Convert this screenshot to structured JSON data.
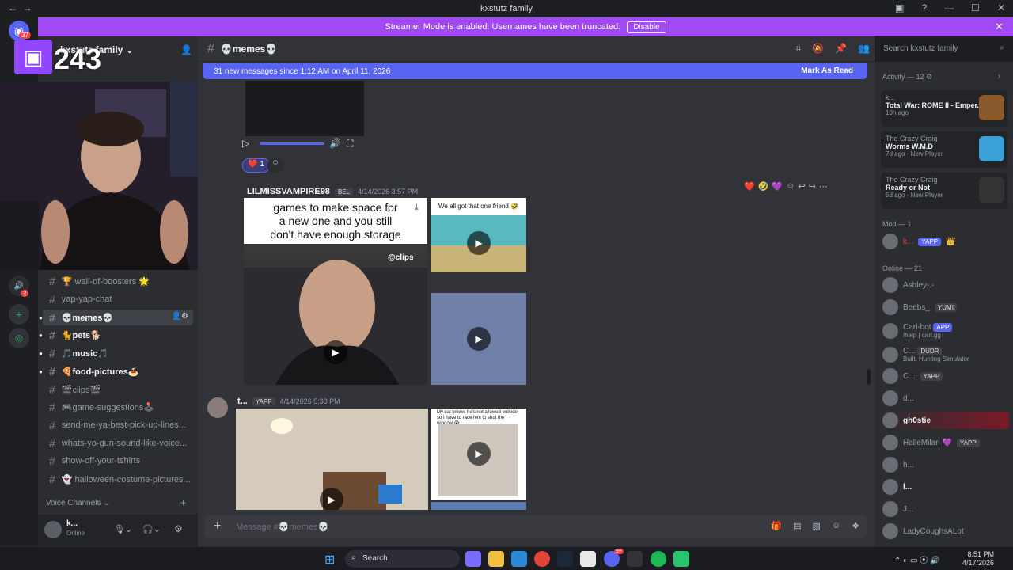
{
  "window": {
    "title": "kxstutz family"
  },
  "banner": {
    "text": "Streamer Mode is enabled. Usernames have been truncated.",
    "button": "Disable"
  },
  "server": {
    "name": "kxstutz family"
  },
  "overlay": {
    "viewer_count": "243"
  },
  "rail": {
    "badges": [
      "37",
      "2"
    ]
  },
  "channels": [
    {
      "label": "🏆 wall-of-boosters 🌟",
      "style": "normal"
    },
    {
      "label": "yap-yap-chat",
      "style": "normal"
    },
    {
      "label": "💀memes💀",
      "style": "active"
    },
    {
      "label": "🐈pets🐕",
      "style": "bold"
    },
    {
      "label": "🎵music🎵",
      "style": "bold"
    },
    {
      "label": "🍕food-pictures🍝",
      "style": "bold"
    },
    {
      "label": "🎬clips🎬",
      "style": "normal"
    },
    {
      "label": "🎮game-suggestions🕹️",
      "style": "normal"
    },
    {
      "label": "send-me-ya-best-pick-up-lines...",
      "style": "normal"
    },
    {
      "label": "whats-yo-gun-sound-like-voice...",
      "style": "normal"
    },
    {
      "label": "show-off-your-tshirts",
      "style": "normal"
    },
    {
      "label": "👻 halloween-costume-pictures...",
      "style": "normal"
    }
  ],
  "voice_header": "Voice Channels",
  "user_panel": {
    "name": "k...",
    "status": "Online"
  },
  "header": {
    "channel": "💀memes💀",
    "search_placeholder": "Search kxstutz family"
  },
  "new_messages": {
    "text": "31 new messages since 1:12 AM on April 11, 2026",
    "action": "Mark As Read"
  },
  "reactions": {
    "count": "1"
  },
  "messages": [
    {
      "author": "LILMISSVAMPIRE98",
      "tag": "BEL",
      "timestamp": "4/14/2026 3:57 PM",
      "caption_lines": [
        "games to make space for",
        "a new one and you still",
        "don't have enough storage"
      ],
      "watermark": "@clips",
      "side_caption": "We all got that one friend 🤣"
    },
    {
      "author": "t...",
      "tag": "YAPP",
      "timestamp": "4/14/2026 5:38 PM",
      "side_caption": "My cat knows he's not allowed outside so I have to race him to shut the window 😭"
    }
  ],
  "composer": {
    "placeholder": "Message #💀memes💀"
  },
  "activity": {
    "header": "Activity — 12",
    "cards": [
      {
        "user": "k...",
        "title": "Total War: ROME II - Emper...",
        "meta": "10h ago"
      },
      {
        "user": "The Crazy Craig",
        "title": "Worms W.M.D",
        "meta": "7d ago",
        "extra": "New Player"
      },
      {
        "user": "The Crazy Craig",
        "title": "Ready or Not",
        "meta": "5d ago",
        "extra": "New Player"
      }
    ]
  },
  "mod_section": {
    "header": "Mod — 1",
    "members": [
      {
        "name": "k...",
        "tag": "YAPP"
      }
    ]
  },
  "online_section": {
    "header": "Online — 21",
    "members": [
      {
        "name": "Ashley-.-",
        "tag": "",
        "sub": ""
      },
      {
        "name": "Beebs_",
        "tag": "YUMI",
        "sub": ""
      },
      {
        "name": "Carl-bot",
        "tag": "APP",
        "sub": "/help | carl.gg"
      },
      {
        "name": "C...",
        "tag": "DUDR",
        "sub": "Built: Hunting Simulator"
      },
      {
        "name": "C...",
        "tag": "YAPP",
        "sub": ""
      },
      {
        "name": "d...",
        "tag": "",
        "sub": ""
      },
      {
        "name": "gh0stie",
        "tag": "",
        "sub": ""
      },
      {
        "name": "HalleMilan 💜",
        "tag": "YAPP",
        "sub": ""
      },
      {
        "name": "h...",
        "tag": "",
        "sub": ""
      },
      {
        "name": "l...",
        "tag": "",
        "sub": ""
      },
      {
        "name": "J...",
        "tag": "",
        "sub": ""
      },
      {
        "name": "LadyCoughsALot",
        "tag": "",
        "sub": ""
      }
    ]
  },
  "taskbar": {
    "search": "Search",
    "time": "8:51 PM",
    "date": "4/17/2026",
    "discord_badge": "9+"
  },
  "colors": {
    "accent": "#5865f2",
    "banner": "#a149f5",
    "twitch": "#9146ff"
  }
}
